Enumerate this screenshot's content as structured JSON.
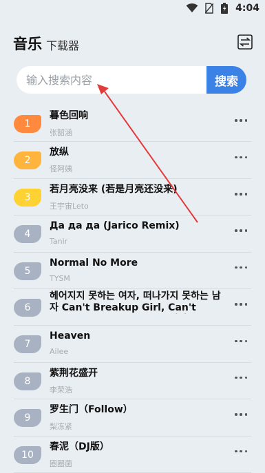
{
  "status_bar": {
    "time": "4:04",
    "icons": [
      "wifi-icon",
      "no-sim-icon",
      "battery-icon"
    ]
  },
  "header": {
    "title": "音乐",
    "subtitle": "下载器",
    "action_icon": "switch-icon"
  },
  "search": {
    "placeholder": "输入搜索内容",
    "button_label": "搜索"
  },
  "colors": {
    "rank_1": "#ff8a3d",
    "rank_2": "#ffb53d",
    "rank_3": "#ffd234",
    "rank_other": "#a9b2c3",
    "search_button": "#3b82e6",
    "annotation_arrow": "#e23b3b"
  },
  "songs": [
    {
      "rank": "1",
      "title": "暮色回响",
      "artist": "张韶涵"
    },
    {
      "rank": "2",
      "title": "放纵",
      "artist": "怪阿姨"
    },
    {
      "rank": "3",
      "title": "若月亮没来 (若是月亮还没来)",
      "artist": "王宇宙Leto"
    },
    {
      "rank": "4",
      "title": "Да да да (Jarico Remix)",
      "artist": "Tanir"
    },
    {
      "rank": "5",
      "title": "Normal No More",
      "artist": "TYSM"
    },
    {
      "rank": "6",
      "title": "헤어지지 못하는 여자, 떠나가지 못하는 남자 Can't Breakup Girl, Can't Breakaway Boy (feat. 정인 Jung In)",
      "artist": ""
    },
    {
      "rank": "7",
      "title": "Heaven",
      "artist": "Ailee"
    },
    {
      "rank": "8",
      "title": "紫荆花盛开",
      "artist": "李荣浩"
    },
    {
      "rank": "9",
      "title": "罗生门（Follow）",
      "artist": "梨冻紧"
    },
    {
      "rank": "10",
      "title": "春泥（DJ版）",
      "artist": "圈圈菌"
    }
  ]
}
